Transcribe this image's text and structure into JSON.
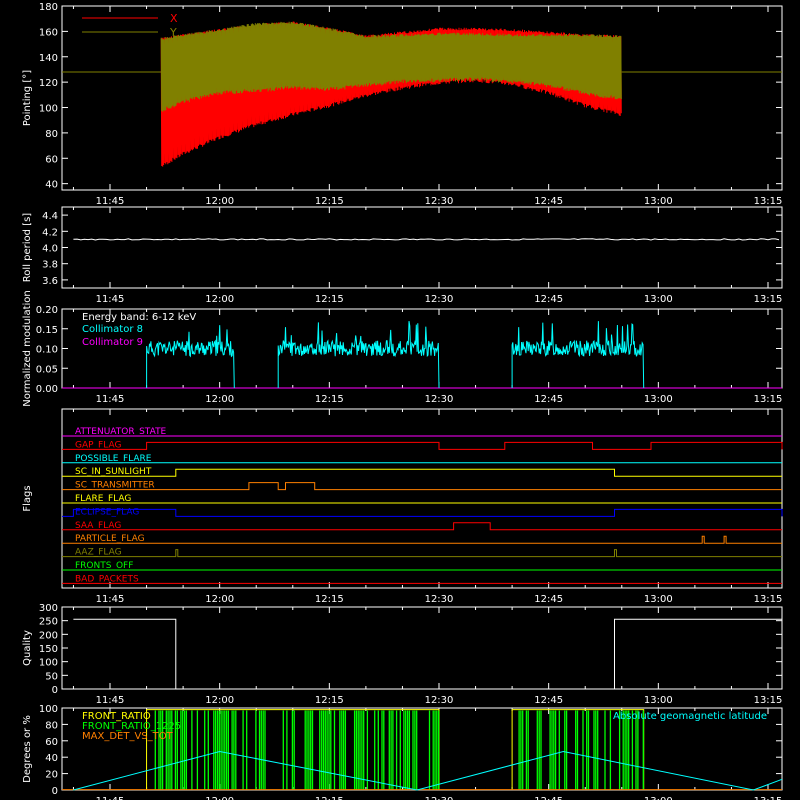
{
  "chart_data": [
    {
      "type": "line",
      "ylabel": "Pointing [°]",
      "xticks": [
        "11:45",
        "12:00",
        "12:15",
        "12:30",
        "12:45",
        "13:00",
        "13:15"
      ],
      "ylim": [
        35,
        180
      ],
      "yticks": [
        40,
        60,
        80,
        100,
        120,
        140,
        160,
        180
      ],
      "legend": "top-left",
      "series": [
        {
          "name": "X",
          "color": "#ff0000",
          "baseline": 128,
          "active_range": [
            "11:52",
            "12:55"
          ],
          "envelope": [
            {
              "t": "11:52",
              "lo": 52,
              "hi": 155
            },
            {
              "t": "11:55",
              "lo": 62,
              "hi": 158
            },
            {
              "t": "12:00",
              "lo": 75,
              "hi": 162
            },
            {
              "t": "12:05",
              "lo": 85,
              "hi": 166
            },
            {
              "t": "12:10",
              "lo": 93,
              "hi": 168
            },
            {
              "t": "12:15",
              "lo": 100,
              "hi": 163
            },
            {
              "t": "12:20",
              "lo": 108,
              "hi": 157
            },
            {
              "t": "12:25",
              "lo": 114,
              "hi": 160
            },
            {
              "t": "12:30",
              "lo": 118,
              "hi": 163
            },
            {
              "t": "12:35",
              "lo": 120,
              "hi": 163
            },
            {
              "t": "12:40",
              "lo": 117,
              "hi": 162
            },
            {
              "t": "12:45",
              "lo": 110,
              "hi": 160
            },
            {
              "t": "12:50",
              "lo": 100,
              "hi": 158
            },
            {
              "t": "12:55",
              "lo": 93,
              "hi": 157
            }
          ]
        },
        {
          "name": "Y",
          "color": "#808000",
          "baseline": 128,
          "active_range": [
            "11:52",
            "12:55"
          ],
          "envelope": [
            {
              "t": "11:52",
              "lo": 96,
              "hi": 155
            },
            {
              "t": "11:55",
              "lo": 103,
              "hi": 158
            },
            {
              "t": "12:00",
              "lo": 110,
              "hi": 162
            },
            {
              "t": "12:05",
              "lo": 112,
              "hi": 167
            },
            {
              "t": "12:10",
              "lo": 114,
              "hi": 168
            },
            {
              "t": "12:15",
              "lo": 113,
              "hi": 163
            },
            {
              "t": "12:20",
              "lo": 116,
              "hi": 157
            },
            {
              "t": "12:25",
              "lo": 119,
              "hi": 158
            },
            {
              "t": "12:30",
              "lo": 120,
              "hi": 159
            },
            {
              "t": "12:35",
              "lo": 121,
              "hi": 159
            },
            {
              "t": "12:40",
              "lo": 119,
              "hi": 158
            },
            {
              "t": "12:45",
              "lo": 116,
              "hi": 158
            },
            {
              "t": "12:50",
              "lo": 110,
              "hi": 158
            },
            {
              "t": "12:55",
              "lo": 105,
              "hi": 157
            }
          ]
        }
      ]
    },
    {
      "type": "line",
      "ylabel": "Roll period [s]",
      "xticks": [
        "11:45",
        "12:00",
        "12:15",
        "12:30",
        "12:45",
        "13:00",
        "13:15"
      ],
      "ylim": [
        3.5,
        4.5
      ],
      "yticks": [
        "3.6",
        "3.8",
        "4.0",
        "4.2",
        "4.4"
      ],
      "series": [
        {
          "name": "",
          "color": "#ffffff",
          "value": 4.1
        }
      ]
    },
    {
      "type": "line",
      "ylabel": "Normalized modulation",
      "xticks": [
        "11:45",
        "12:00",
        "12:15",
        "12:30",
        "12:45",
        "13:00",
        "13:15"
      ],
      "ylim": [
        0.0,
        0.2
      ],
      "yticks": [
        "0.00",
        "0.05",
        "0.10",
        "0.15",
        "0.20"
      ],
      "annotation": "Energy band: 6-12 keV",
      "series": [
        {
          "name": "Collimator 8",
          "color": "#00ffff",
          "segments": [
            {
              "start": "11:50",
              "end": "12:02",
              "level": 0.1
            },
            {
              "start": "12:08",
              "end": "12:30",
              "level": 0.1
            },
            {
              "start": "12:40",
              "end": "12:58",
              "level": 0.1
            }
          ]
        },
        {
          "name": "Collimator 9",
          "color": "#ff00ff",
          "value": 0.0
        }
      ]
    },
    {
      "type": "line",
      "ylabel": "Flags",
      "xticks": [
        "11:45",
        "12:00",
        "12:15",
        "12:30",
        "12:45",
        "13:00",
        "13:15"
      ],
      "flags": [
        {
          "name": "ATTENUATOR_STATE",
          "color": "#ff00ff",
          "on": []
        },
        {
          "name": "GAP_FLAG",
          "color": "#ff0000",
          "on": [
            [
              "11:50",
              "12:30"
            ],
            [
              "12:39",
              "12:51"
            ],
            [
              "12:59",
              "13:20"
            ]
          ]
        },
        {
          "name": "POSSIBLE_FLARE",
          "color": "#00ffff",
          "on": []
        },
        {
          "name": "SC_IN_SUNLIGHT",
          "color": "#ffff00",
          "on": [
            [
              "11:54",
              "12:54"
            ]
          ]
        },
        {
          "name": "SC_TRANSMITTER",
          "color": "#ff8000",
          "on": [
            [
              "12:04",
              "12:08"
            ],
            [
              "12:09",
              "12:13"
            ]
          ]
        },
        {
          "name": "FLARE_FLAG",
          "color": "#ffff00",
          "on": []
        },
        {
          "name": "ECLIPSE_FLAG",
          "color": "#0000ff",
          "on": [
            [
              "11:40",
              "11:54"
            ],
            [
              "12:54",
              "13:20"
            ]
          ]
        },
        {
          "name": "SAA_FLAG",
          "color": "#ff0000",
          "on": [
            [
              "12:32",
              "12:37"
            ]
          ]
        },
        {
          "name": "PARTICLE_FLAG",
          "color": "#ff8000",
          "on": [
            [
              "13:06",
              "13:06"
            ],
            [
              "13:09",
              "13:09"
            ]
          ]
        },
        {
          "name": "AAZ_FLAG",
          "color": "#808000",
          "on": [
            [
              "11:54",
              "11:54"
            ],
            [
              "12:54",
              "12:54"
            ]
          ]
        },
        {
          "name": "FRONTS_OFF",
          "color": "#00ff00",
          "on": []
        },
        {
          "name": "BAD_PACKETS",
          "color": "#ff0000",
          "on": []
        }
      ]
    },
    {
      "type": "line",
      "ylabel": "Quality",
      "xticks": [
        "11:45",
        "12:00",
        "12:15",
        "12:30",
        "12:45",
        "13:00",
        "13:15"
      ],
      "ylim": [
        0,
        300
      ],
      "yticks": [
        0,
        50,
        100,
        150,
        200,
        250,
        300
      ],
      "series": [
        {
          "name": "",
          "color": "#ffffff",
          "points": [
            [
              "11:40",
              255
            ],
            [
              "11:54",
              255
            ],
            [
              "11:54",
              0
            ],
            [
              "12:54",
              0
            ],
            [
              "12:54",
              255
            ],
            [
              "13:20",
              255
            ]
          ]
        }
      ]
    },
    {
      "type": "line",
      "ylabel": "Degrees or %",
      "xticks": [
        "11:45",
        "12:00",
        "12:15",
        "12:30",
        "12:45",
        "13:00",
        "13:15"
      ],
      "ylim": [
        0,
        100
      ],
      "yticks": [
        0,
        20,
        40,
        60,
        80,
        100
      ],
      "series": [
        {
          "name": "FRONT_RATIO",
          "color": "#ffff00"
        },
        {
          "name": "FRONT_RATIO_1225",
          "color": "#00ff00"
        },
        {
          "name": "MAX_DET_VS_TOT",
          "color": "#ff8000"
        },
        {
          "name": "Absolute geomagnetic latitude",
          "color": "#00ffff",
          "points": [
            [
              "11:40",
              0
            ],
            [
              "12:00",
              47
            ],
            [
              "12:27",
              0
            ],
            [
              "12:47",
              47
            ],
            [
              "13:13",
              0
            ],
            [
              "13:20",
              13
            ]
          ]
        }
      ],
      "active_windows": [
        [
          "11:50",
          "12:30"
        ],
        [
          "12:40",
          "12:58"
        ]
      ]
    }
  ]
}
